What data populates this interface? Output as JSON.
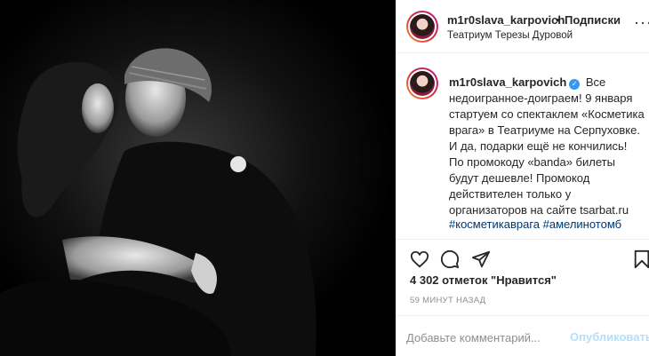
{
  "post": {
    "photo_alt": "",
    "header": {
      "username": "m1r0slava_karpovich",
      "dot": "•",
      "follow_label": "Подписки",
      "location": "Театриум Терезы Дуровой",
      "more_icon": "more-horizontal-icon"
    },
    "caption": {
      "username": "m1r0slava_karpovich",
      "verified_icon": "verified-badge-icon",
      "text": "Все недоигранное-доиграем! 9 января стартуем со спектаклем «Косметика врага» в Театриуме на Серпуховке. И да, подарки ещё не кончились! По промокоду «banda» билеты будут дешевле! Промокод действителен только у организаторов на сайте tsarbat.ru",
      "hashtag1": "#косметикаврага",
      "hashtag2": "#амелинотомб"
    },
    "actions": {
      "like_icon": "heart-icon",
      "comment_icon": "comment-icon",
      "share_icon": "send-icon",
      "save_icon": "bookmark-icon"
    },
    "likes": "4 302 отметок \"Нравится\"",
    "time": "59 МИНУТ НАЗАД",
    "comment": {
      "placeholder": "Добавьте комментарий...",
      "publish_label": "Опубликовать"
    },
    "colors": {
      "link": "#00376b",
      "verified": "#3897f0",
      "publish_disabled": "#b2dffc",
      "muted": "#8e8e8e"
    }
  }
}
